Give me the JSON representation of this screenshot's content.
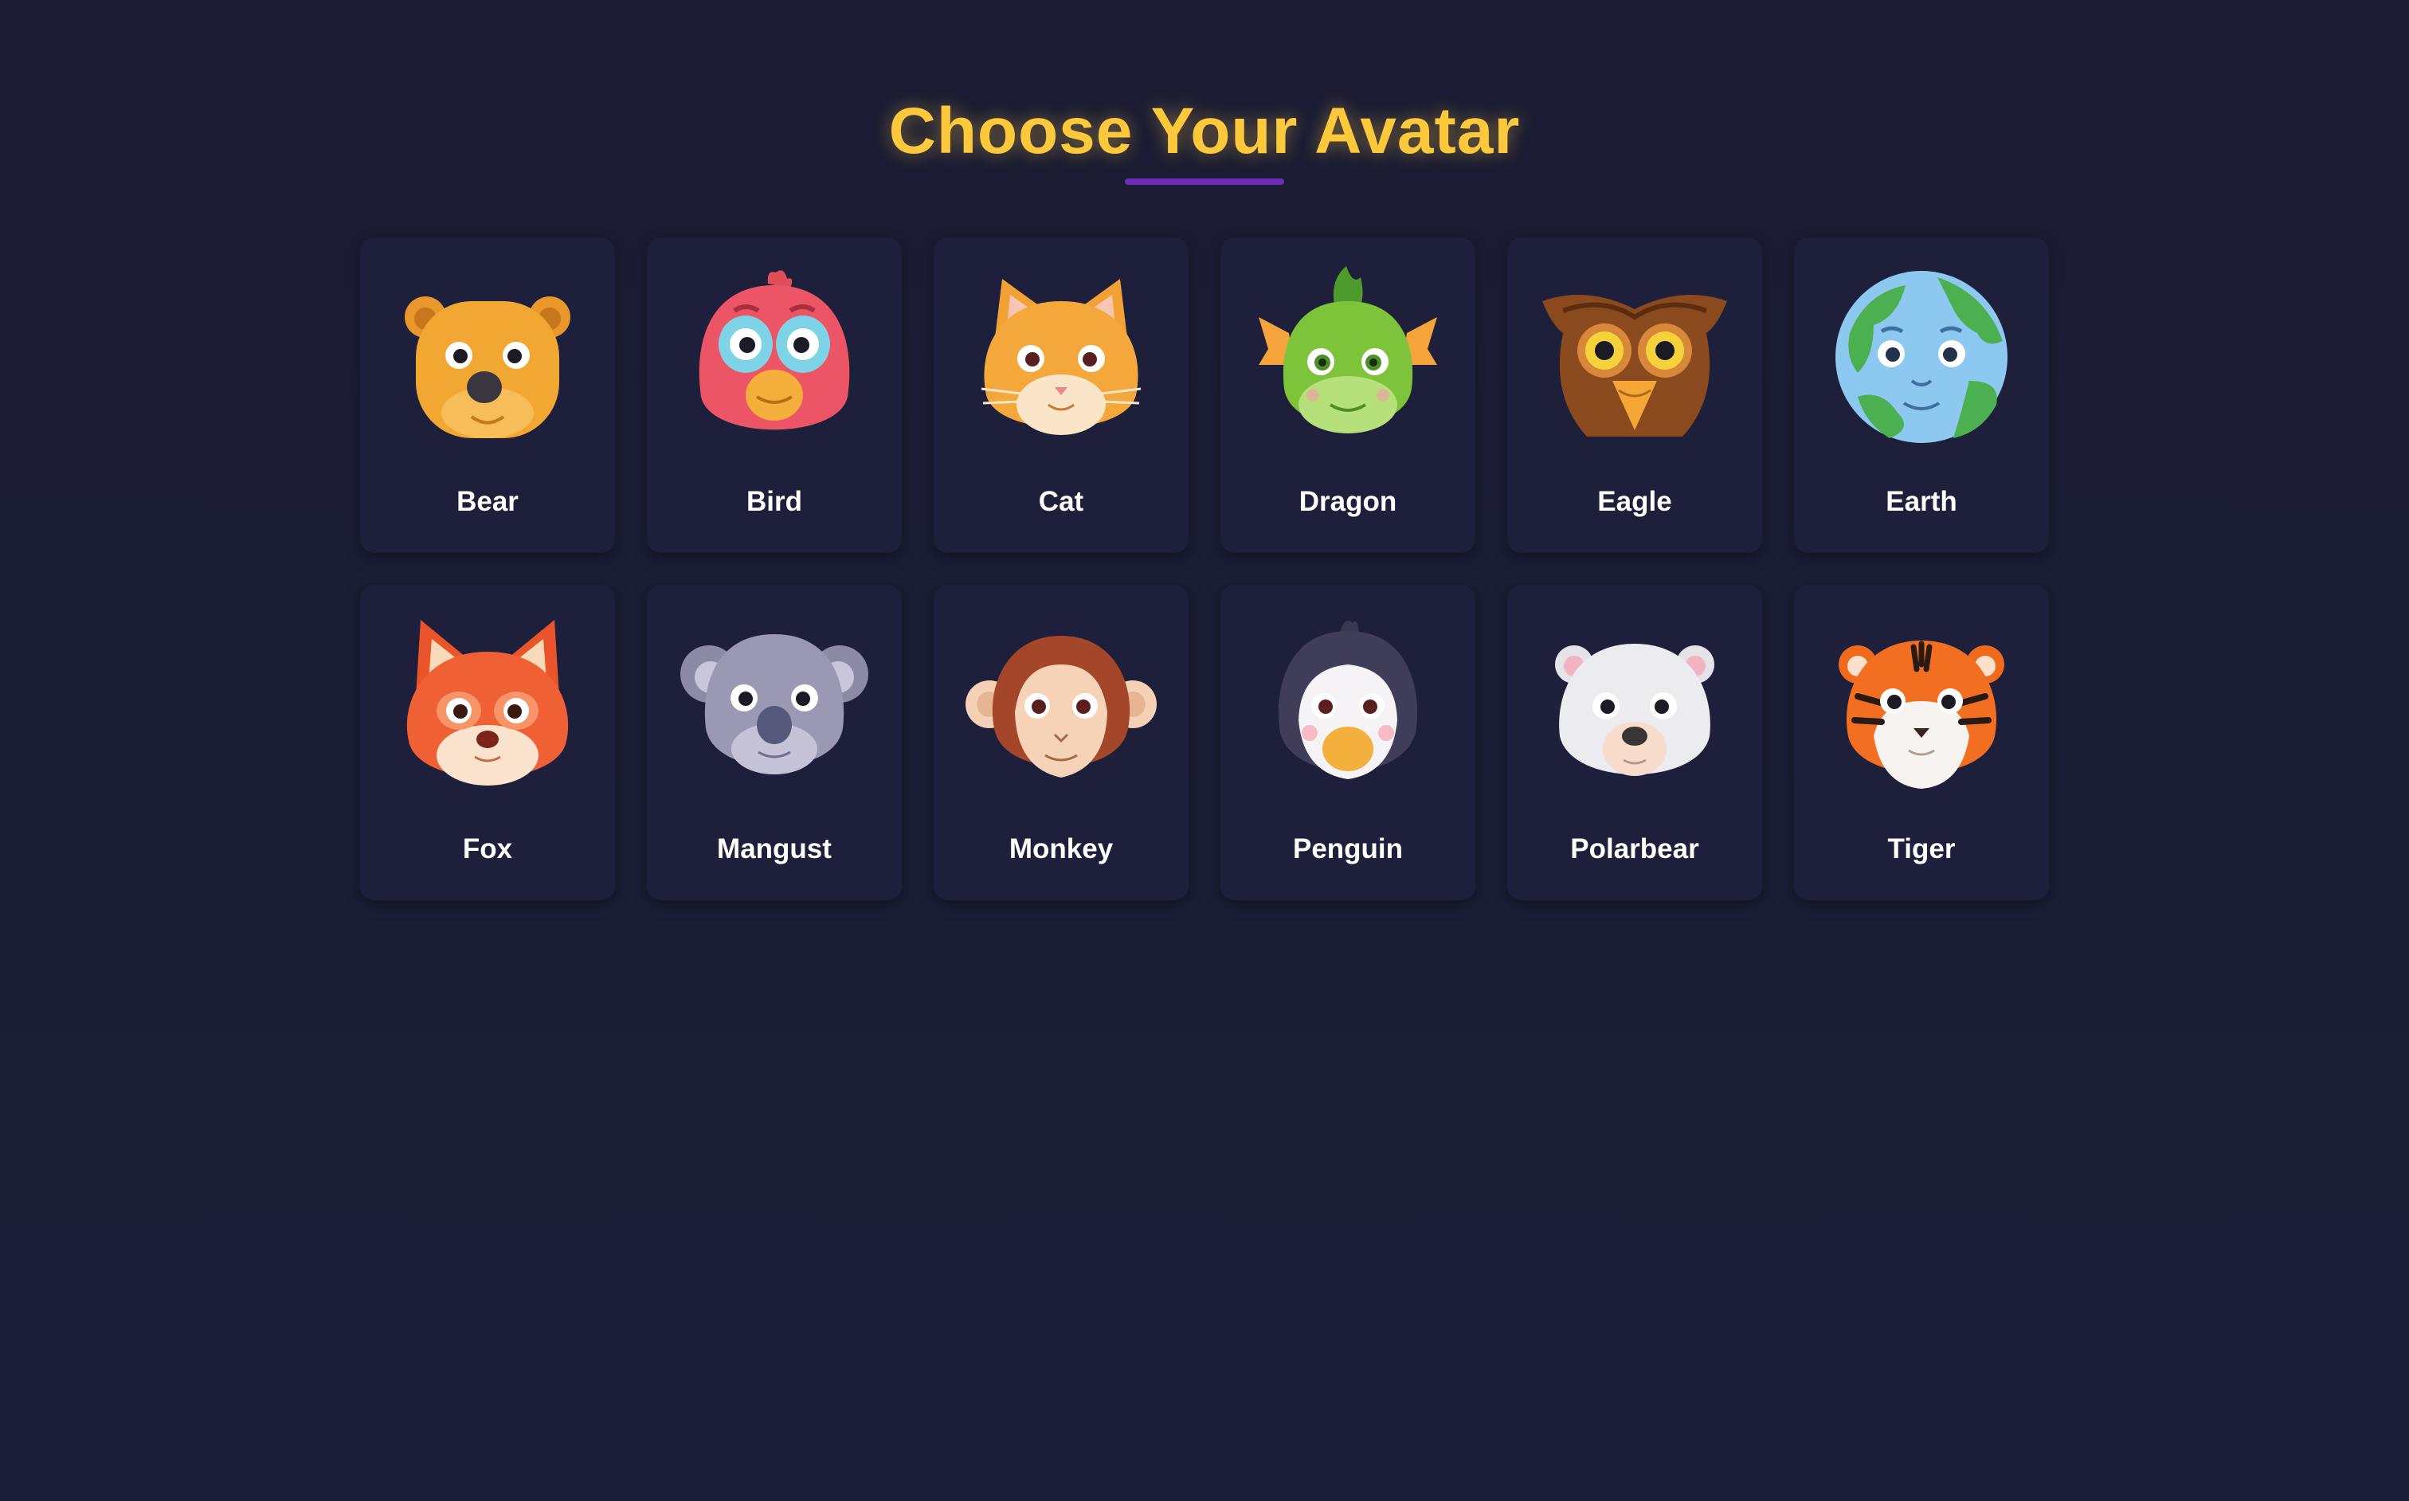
{
  "header": {
    "title": "Choose Your Avatar"
  },
  "avatars": [
    {
      "label": "Bear",
      "icon": "bear-icon"
    },
    {
      "label": "Bird",
      "icon": "bird-icon"
    },
    {
      "label": "Cat",
      "icon": "cat-icon"
    },
    {
      "label": "Dragon",
      "icon": "dragon-icon"
    },
    {
      "label": "Eagle",
      "icon": "eagle-icon"
    },
    {
      "label": "Earth",
      "icon": "earth-icon"
    },
    {
      "label": "Fox",
      "icon": "fox-icon"
    },
    {
      "label": "Mangust",
      "icon": "mangust-icon"
    },
    {
      "label": "Monkey",
      "icon": "monkey-icon"
    },
    {
      "label": "Penguin",
      "icon": "penguin-icon"
    },
    {
      "label": "Polarbear",
      "icon": "polarbear-icon"
    },
    {
      "label": "Tiger",
      "icon": "tiger-icon"
    }
  ],
  "colors": {
    "background": "#1a1c33",
    "card": "#1d1f3b",
    "title": "#fcc93d",
    "underline": "#6f2bb8"
  }
}
